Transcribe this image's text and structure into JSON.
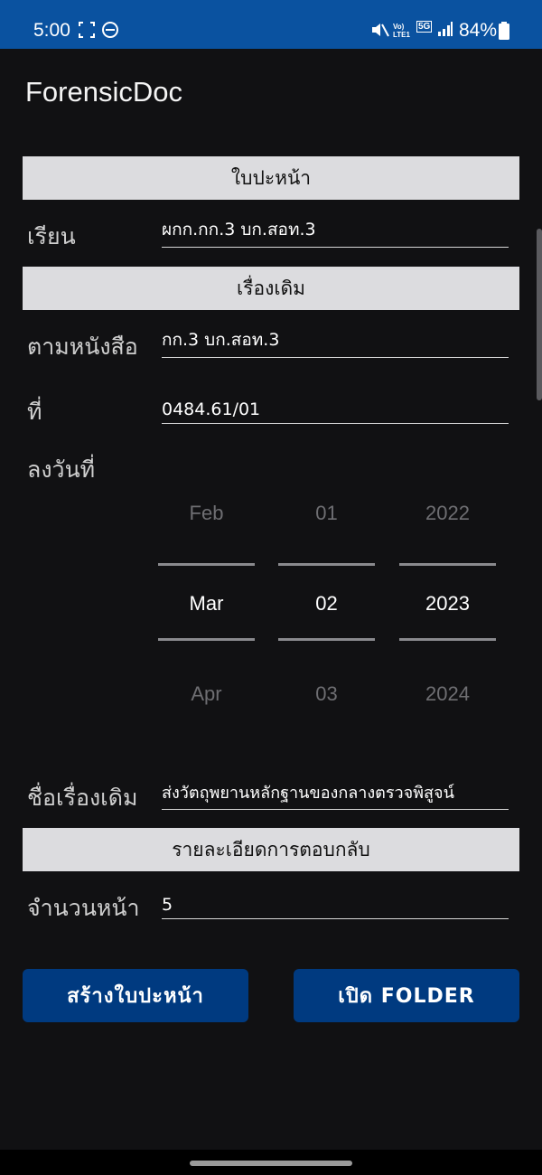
{
  "status_bar": {
    "time": "5:00",
    "network_label": "Vo) LTE1",
    "network_type": "5G",
    "battery": "84%",
    "bg_color": "#0a52a0"
  },
  "app": {
    "title": "ForensicDoc"
  },
  "sections": {
    "cover": "ใบปะหน้า",
    "original_matter": "เรื่องเดิม",
    "reply_details": "รายละเอียดการตอบกลับ"
  },
  "fields": {
    "to_label": "เรียน",
    "to_value": "ผกก.กก.3 บก.สอท.3",
    "per_letter_label": "ตามหนังสือ",
    "per_letter_value": "กก.3 บก.สอท.3",
    "ref_label": "ที่",
    "ref_value": "0484.61/01",
    "date_label": "ลงวันที่",
    "subject_label": "ชื่อเรื่องเดิม",
    "subject_value": "ส่งวัตถุพยานหลักฐานของกลางตรวจพิสูจน์",
    "pages_label": "จำนวนหน้า",
    "pages_value": "5"
  },
  "date_picker": {
    "month": {
      "prev": "Feb",
      "selected": "Mar",
      "next": "Apr"
    },
    "day": {
      "prev": "01",
      "selected": "02",
      "next": "03"
    },
    "year": {
      "prev": "2022",
      "selected": "2023",
      "next": "2024"
    }
  },
  "buttons": {
    "create_cover": "สร้างใบปะหน้า",
    "open_folder": "เปิด FOLDER"
  },
  "colors": {
    "background": "#111113",
    "section_header": "#dcdcdf",
    "button": "#003a80"
  }
}
